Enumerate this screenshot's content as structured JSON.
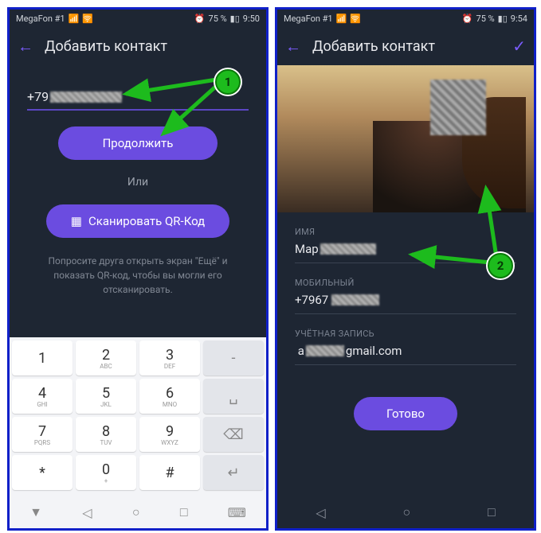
{
  "left": {
    "status": {
      "carrier": "MegaFon #1",
      "battery": "75 %",
      "time": "9:50",
      "alarm": "⏰"
    },
    "header_title": "Добавить контакт",
    "phone_prefix": "+79",
    "continue_label": "Продолжить",
    "or_label": "Или",
    "qr_label": "Сканировать QR-Код",
    "help_text": "Попросите друга открыть экран \"Ещё\" и показать QR-код, чтобы вы могли его отсканировать.",
    "keyboard": {
      "r1": [
        "1",
        "2",
        "3",
        "-"
      ],
      "r1sub": [
        "",
        "ABC",
        "DEF",
        ""
      ],
      "r2": [
        "4",
        "5",
        "6",
        ""
      ],
      "r2sub": [
        "GHI",
        "JKL",
        "MNO",
        ""
      ],
      "r3": [
        "7",
        "8",
        "9",
        "⌫"
      ],
      "r3sub": [
        "PQRS",
        "TUV",
        "WXYZ",
        ""
      ],
      "r4": [
        "*",
        "0",
        "#",
        "↵"
      ],
      "r4sub": [
        "",
        "+",
        "",
        ""
      ]
    }
  },
  "right": {
    "status": {
      "carrier": "MegaFon #1",
      "battery": "75 %",
      "time": "9:54",
      "alarm": "⏰"
    },
    "header_title": "Добавить контакт",
    "name_label": "ИМЯ",
    "name_value": "Мар",
    "mobile_label": "МОБИЛЬНЫЙ",
    "mobile_value": "+7967",
    "account_label": "УЧЁТНАЯ ЗАПИСЬ",
    "account_value_prefix": "a",
    "account_value_suffix": "gmail.com",
    "done_label": "Готово"
  },
  "markers": {
    "m1": "1",
    "m2": "2"
  }
}
